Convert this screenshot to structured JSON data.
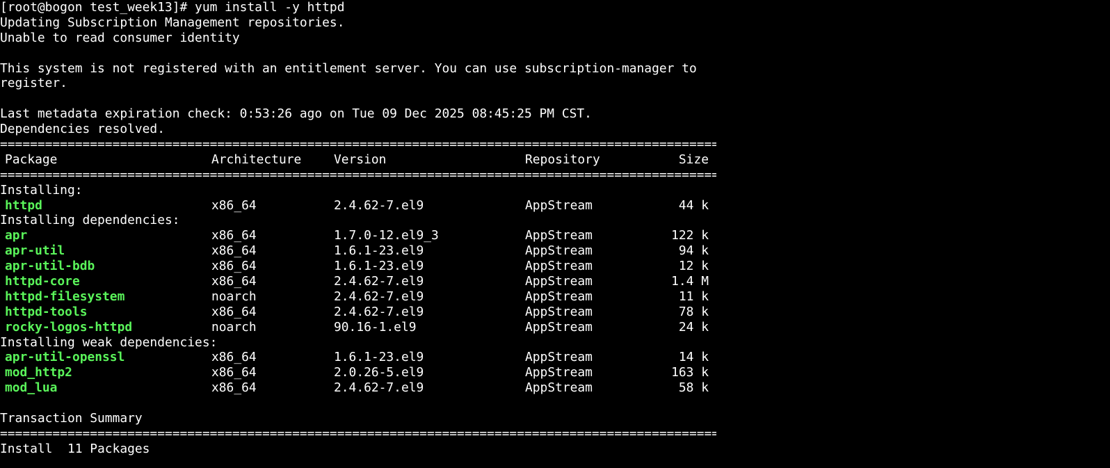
{
  "terminal": {
    "prompt": "[root@bogon test_week13]# yum install -y httpd",
    "lines_pre": [
      "Updating Subscription Management repositories.",
      "Unable to read consumer identity",
      "",
      "This system is not registered with an entitlement server. You can use subscription-manager to",
      "register.",
      "",
      "Last metadata expiration check: 0:53:26 ago on Tue 09 Dec 2025 08:45:25 PM CST.",
      "Dependencies resolved."
    ],
    "separator": "================================================================================================",
    "headers": {
      "package": "Package",
      "architecture": "Architecture",
      "version": "Version",
      "repository": "Repository",
      "size": "Size"
    },
    "sections": [
      {
        "title": "Installing:",
        "rows": [
          {
            "package": "httpd",
            "arch": "x86_64",
            "version": "2.4.62-7.el9",
            "repo": "AppStream",
            "size": "44 k"
          }
        ]
      },
      {
        "title": "Installing dependencies:",
        "rows": [
          {
            "package": "apr",
            "arch": "x86_64",
            "version": "1.7.0-12.el9_3",
            "repo": "AppStream",
            "size": "122 k"
          },
          {
            "package": "apr-util",
            "arch": "x86_64",
            "version": "1.6.1-23.el9",
            "repo": "AppStream",
            "size": "94 k"
          },
          {
            "package": "apr-util-bdb",
            "arch": "x86_64",
            "version": "1.6.1-23.el9",
            "repo": "AppStream",
            "size": "12 k"
          },
          {
            "package": "httpd-core",
            "arch": "x86_64",
            "version": "2.4.62-7.el9",
            "repo": "AppStream",
            "size": "1.4 M"
          },
          {
            "package": "httpd-filesystem",
            "arch": "noarch",
            "version": "2.4.62-7.el9",
            "repo": "AppStream",
            "size": "11 k"
          },
          {
            "package": "httpd-tools",
            "arch": "x86_64",
            "version": "2.4.62-7.el9",
            "repo": "AppStream",
            "size": "78 k"
          },
          {
            "package": "rocky-logos-httpd",
            "arch": "noarch",
            "version": "90.16-1.el9",
            "repo": "AppStream",
            "size": "24 k"
          }
        ]
      },
      {
        "title": "Installing weak dependencies:",
        "rows": [
          {
            "package": "apr-util-openssl",
            "arch": "x86_64",
            "version": "1.6.1-23.el9",
            "repo": "AppStream",
            "size": "14 k"
          },
          {
            "package": "mod_http2",
            "arch": "x86_64",
            "version": "2.0.26-5.el9",
            "repo": "AppStream",
            "size": "163 k"
          },
          {
            "package": "mod_lua",
            "arch": "x86_64",
            "version": "2.4.62-7.el9",
            "repo": "AppStream",
            "size": "58 k"
          }
        ]
      }
    ],
    "summary_title": "Transaction Summary",
    "summary_line": "Install  11 Packages",
    "colors": {
      "background": "#000000",
      "text": "#ffffff",
      "package_name": "#5af45a"
    }
  }
}
